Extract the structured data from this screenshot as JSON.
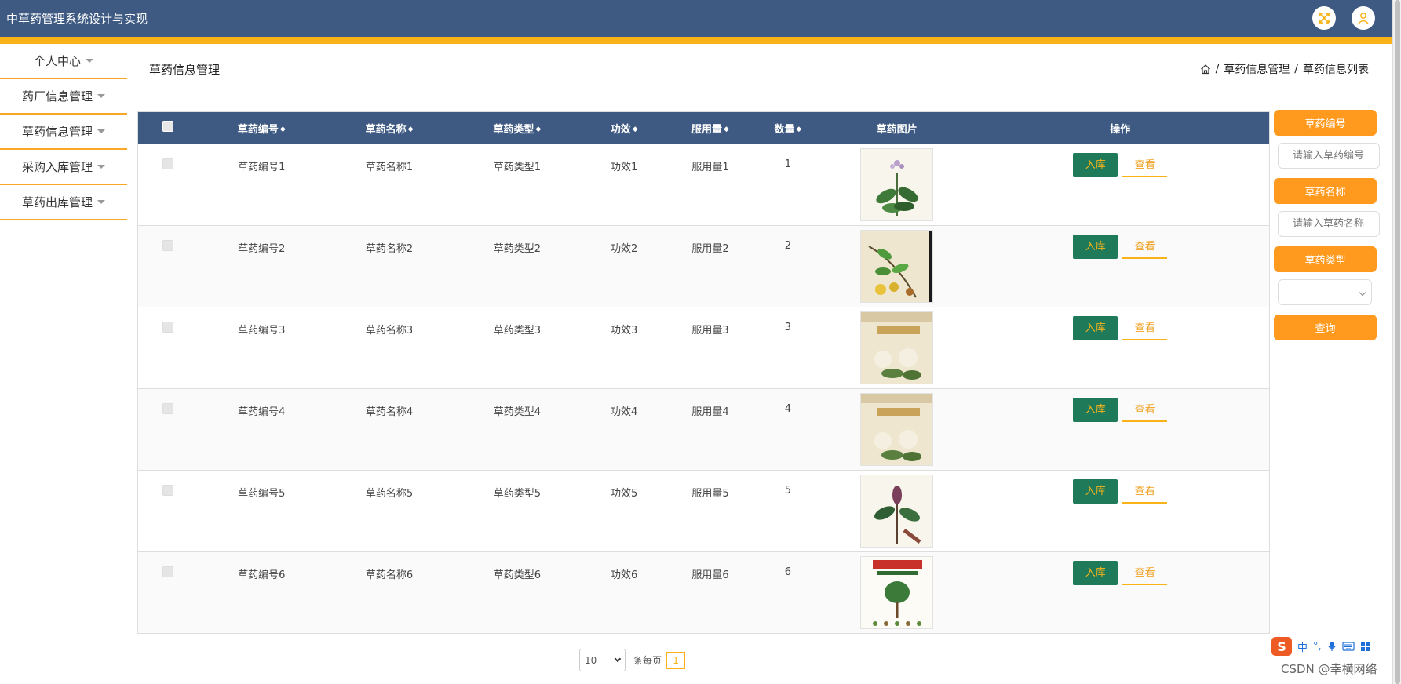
{
  "app": {
    "title": "中草药管理系统设计与实现"
  },
  "header": {
    "fullscreen_icon": "expand-arrows-icon",
    "user_icon": "user-icon"
  },
  "sidebar": {
    "items": [
      {
        "label": "个人中心"
      },
      {
        "label": "药厂信息管理"
      },
      {
        "label": "草药信息管理"
      },
      {
        "label": "采购入库管理"
      },
      {
        "label": "草药出库管理"
      }
    ]
  },
  "page": {
    "title": "草药信息管理",
    "breadcrumb": {
      "home_icon": "home-icon",
      "sep": "/",
      "level1": "草药信息管理",
      "level2": "草药信息列表"
    }
  },
  "table": {
    "headers": {
      "id": "草药编号",
      "name": "草药名称",
      "type": "草药类型",
      "effect": "功效",
      "dosage": "服用量",
      "quantity": "数量",
      "image": "草药图片",
      "actions": "操作"
    },
    "sort_icon": "◆",
    "rows": [
      {
        "id": "草药编号1",
        "name": "草药名称1",
        "type": "草药类型1",
        "effect": "功效1",
        "dosage": "服用量1",
        "quantity": "1"
      },
      {
        "id": "草药编号2",
        "name": "草药名称2",
        "type": "草药类型2",
        "effect": "功效2",
        "dosage": "服用量2",
        "quantity": "2"
      },
      {
        "id": "草药编号3",
        "name": "草药名称3",
        "type": "草药类型3",
        "effect": "功效3",
        "dosage": "服用量3",
        "quantity": "3"
      },
      {
        "id": "草药编号4",
        "name": "草药名称4",
        "type": "草药类型4",
        "effect": "功效4",
        "dosage": "服用量4",
        "quantity": "4"
      },
      {
        "id": "草药编号5",
        "name": "草药名称5",
        "type": "草药类型5",
        "effect": "功效5",
        "dosage": "服用量5",
        "quantity": "5"
      },
      {
        "id": "草药编号6",
        "name": "草药名称6",
        "type": "草药类型6",
        "effect": "功效6",
        "dosage": "服用量6",
        "quantity": "6"
      }
    ],
    "action_stock_in": "入库",
    "action_view": "查看"
  },
  "filters": {
    "id_label": "草药编号",
    "id_placeholder": "请输入草药编号",
    "name_label": "草药名称",
    "name_placeholder": "请输入草药名称",
    "type_label": "草药类型",
    "type_value": "",
    "search_label": "查询"
  },
  "pagination": {
    "page_size": "10",
    "per_page_label": "条每页",
    "current_page": "1"
  },
  "ime": {
    "lang": "中",
    "punct": "°,",
    "logo": "S"
  },
  "watermark": "CSDN @幸横网络",
  "colors": {
    "header": "#3e5a82",
    "accent": "#f9b319",
    "filter_button": "#ff9a1f",
    "stock_in_button": "#1f7a5a"
  }
}
